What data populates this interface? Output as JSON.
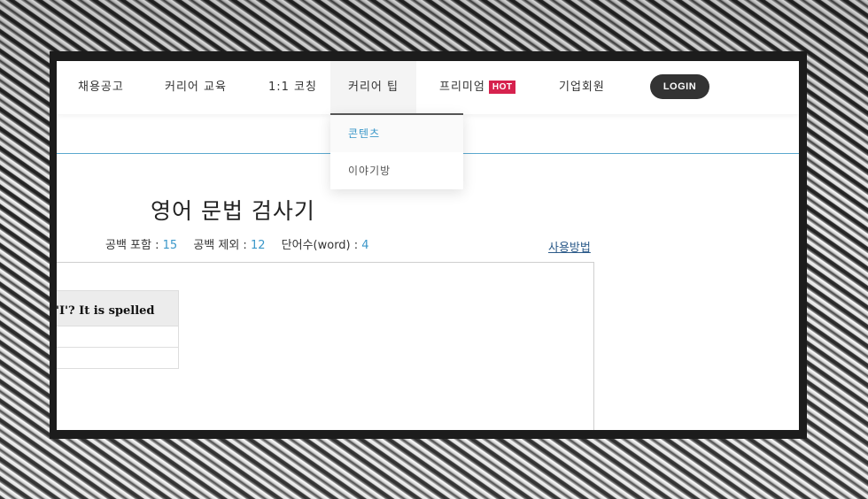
{
  "nav": {
    "items": [
      {
        "label": "채용공고"
      },
      {
        "label": "커리어 교육"
      },
      {
        "label": "1:1 코칭"
      },
      {
        "label": "커리어 팁"
      },
      {
        "label": "프리미엄",
        "badge": "HOT"
      },
      {
        "label": "기업회원"
      }
    ],
    "login_label": "LOGIN"
  },
  "dropdown": {
    "items": [
      {
        "label": "콘텐츠"
      },
      {
        "label": "이야기방"
      }
    ]
  },
  "page": {
    "title": "영어 문법 검사기",
    "stats": {
      "with_spaces_label": "공백 포함 :",
      "with_spaces_value": "15",
      "without_spaces_label": "공백 제외 :",
      "without_spaces_value": "12",
      "word_count_label": "단어수(word) :",
      "word_count_value": "4"
    },
    "usage_link": "사용방법"
  },
  "result": {
    "header_text": "'I'? It is spelled"
  },
  "colors": {
    "accent": "#3a97c9",
    "hot_badge": "#d6224e",
    "login_bg": "#333333"
  }
}
